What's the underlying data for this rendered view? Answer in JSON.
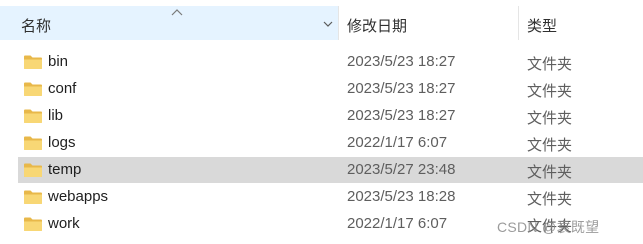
{
  "header": {
    "name_label": "名称",
    "date_label": "修改日期",
    "type_label": "类型"
  },
  "rows": [
    {
      "name": "bin",
      "date": "2023/5/23 18:27",
      "type": "文件夹",
      "selected": false
    },
    {
      "name": "conf",
      "date": "2023/5/23 18:27",
      "type": "文件夹",
      "selected": false
    },
    {
      "name": "lib",
      "date": "2023/5/23 18:27",
      "type": "文件夹",
      "selected": false
    },
    {
      "name": "logs",
      "date": "2022/1/17 6:07",
      "type": "文件夹",
      "selected": false
    },
    {
      "name": "temp",
      "date": "2023/5/27 23:48",
      "type": "文件夹",
      "selected": true
    },
    {
      "name": "webapps",
      "date": "2023/5/23 18:28",
      "type": "文件夹",
      "selected": false
    },
    {
      "name": "work",
      "date": "2022/1/17 6:07",
      "type": "文件夹",
      "selected": false
    }
  ],
  "watermark": "CSDN @袁既望",
  "colors": {
    "header_highlight": "#e5f3ff",
    "selected_row": "#d9d9d9",
    "folder_yellow": "#f8d775"
  },
  "icons": {
    "folder": "folder-icon",
    "sort": "sort-ascending-icon",
    "dropdown": "chevron-down-icon"
  }
}
